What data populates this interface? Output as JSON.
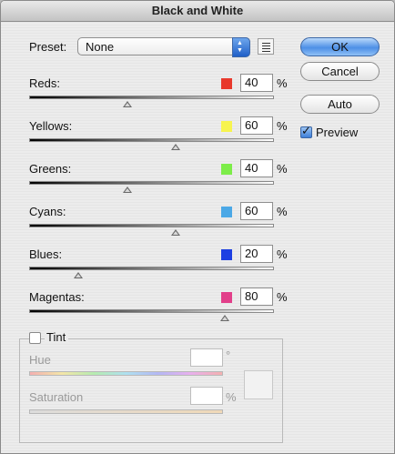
{
  "window": {
    "title": "Black and White"
  },
  "preset": {
    "label": "Preset:",
    "value": "None"
  },
  "buttons": {
    "ok": "OK",
    "cancel": "Cancel",
    "auto": "Auto"
  },
  "preview": {
    "label": "Preview",
    "checked": true
  },
  "percent": "%",
  "sliders": [
    {
      "label": "Reds:",
      "value": "40",
      "color": "#e8392c",
      "level_percent": 40
    },
    {
      "label": "Yellows:",
      "value": "60",
      "color": "#f7f44f",
      "level_percent": 60
    },
    {
      "label": "Greens:",
      "value": "40",
      "color": "#7ded49",
      "level_percent": 40
    },
    {
      "label": "Cyans:",
      "value": "60",
      "color": "#4ba8e6",
      "level_percent": 60
    },
    {
      "label": "Blues:",
      "value": "20",
      "color": "#1d3fe2",
      "level_percent": 20
    },
    {
      "label": "Magentas:",
      "value": "80",
      "color": "#e23f8a",
      "level_percent": 80
    }
  ],
  "tint": {
    "label": "Tint",
    "checked": false,
    "hue_label": "Hue",
    "hue_value": "",
    "degree": "°",
    "saturation_label": "Saturation",
    "saturation_value": "",
    "saturation_unit": "%"
  }
}
